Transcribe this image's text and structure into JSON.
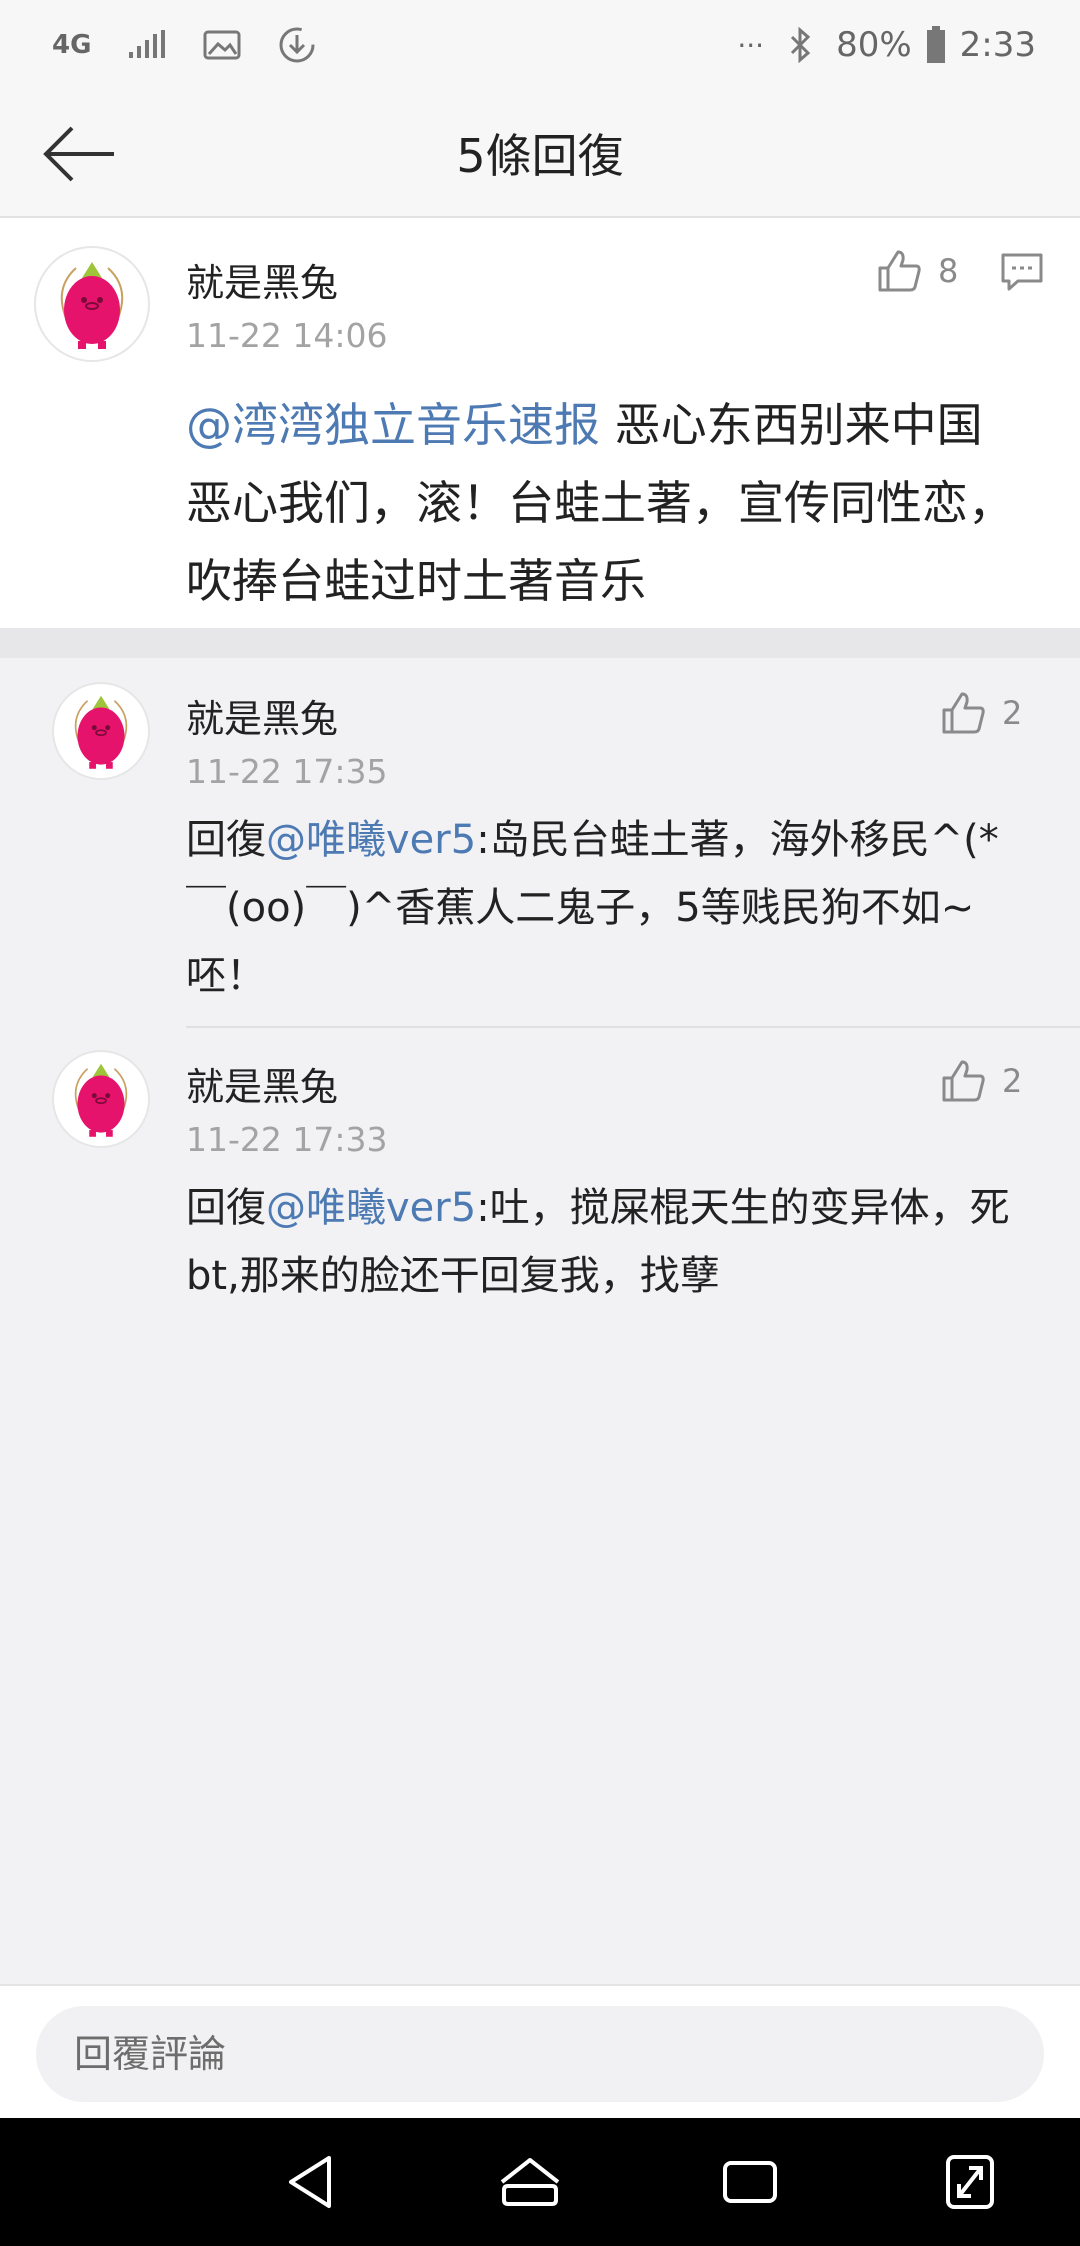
{
  "status_bar": {
    "network": "4G",
    "dots": "···",
    "battery": "80%",
    "time": "2:33",
    "icons": [
      "signal-icon",
      "image-icon",
      "download-icon",
      "bluetooth-icon",
      "battery-icon"
    ]
  },
  "header": {
    "title": "5條回復",
    "back_icon": "arrow-left-icon"
  },
  "main_comment": {
    "username": "就是黑兔",
    "timestamp": "11-22 14:06",
    "likes": "8",
    "mention": "@湾湾独立音乐速报",
    "text": " 恶心东西别来中国恶心我们，滚！台蛙土著，宣传同性恋，吹捧台蛙过时土著音乐"
  },
  "replies": [
    {
      "username": "就是黑兔",
      "timestamp": "11-22 17:35",
      "likes": "2",
      "prefix": "回復",
      "mention": "@唯曦ver5",
      "text": ":岛民台蛙土著，海外移民^(*￣(oo)￣)^香蕉人二鬼子，5等贱民狗不如~呸！"
    },
    {
      "username": "就是黑兔",
      "timestamp": "11-22 17:33",
      "likes": "2",
      "prefix": "回復",
      "mention": "@唯曦ver5",
      "text": ":吐，搅屎棍天生的变异体，死bt,那来的脸还干回复我，找孽"
    }
  ],
  "bottom": {
    "placeholder": "回覆評論"
  },
  "colors": {
    "mention": "#4d7ab3",
    "avatar_pink": "#e6136c",
    "background": "#f2f2f5"
  }
}
